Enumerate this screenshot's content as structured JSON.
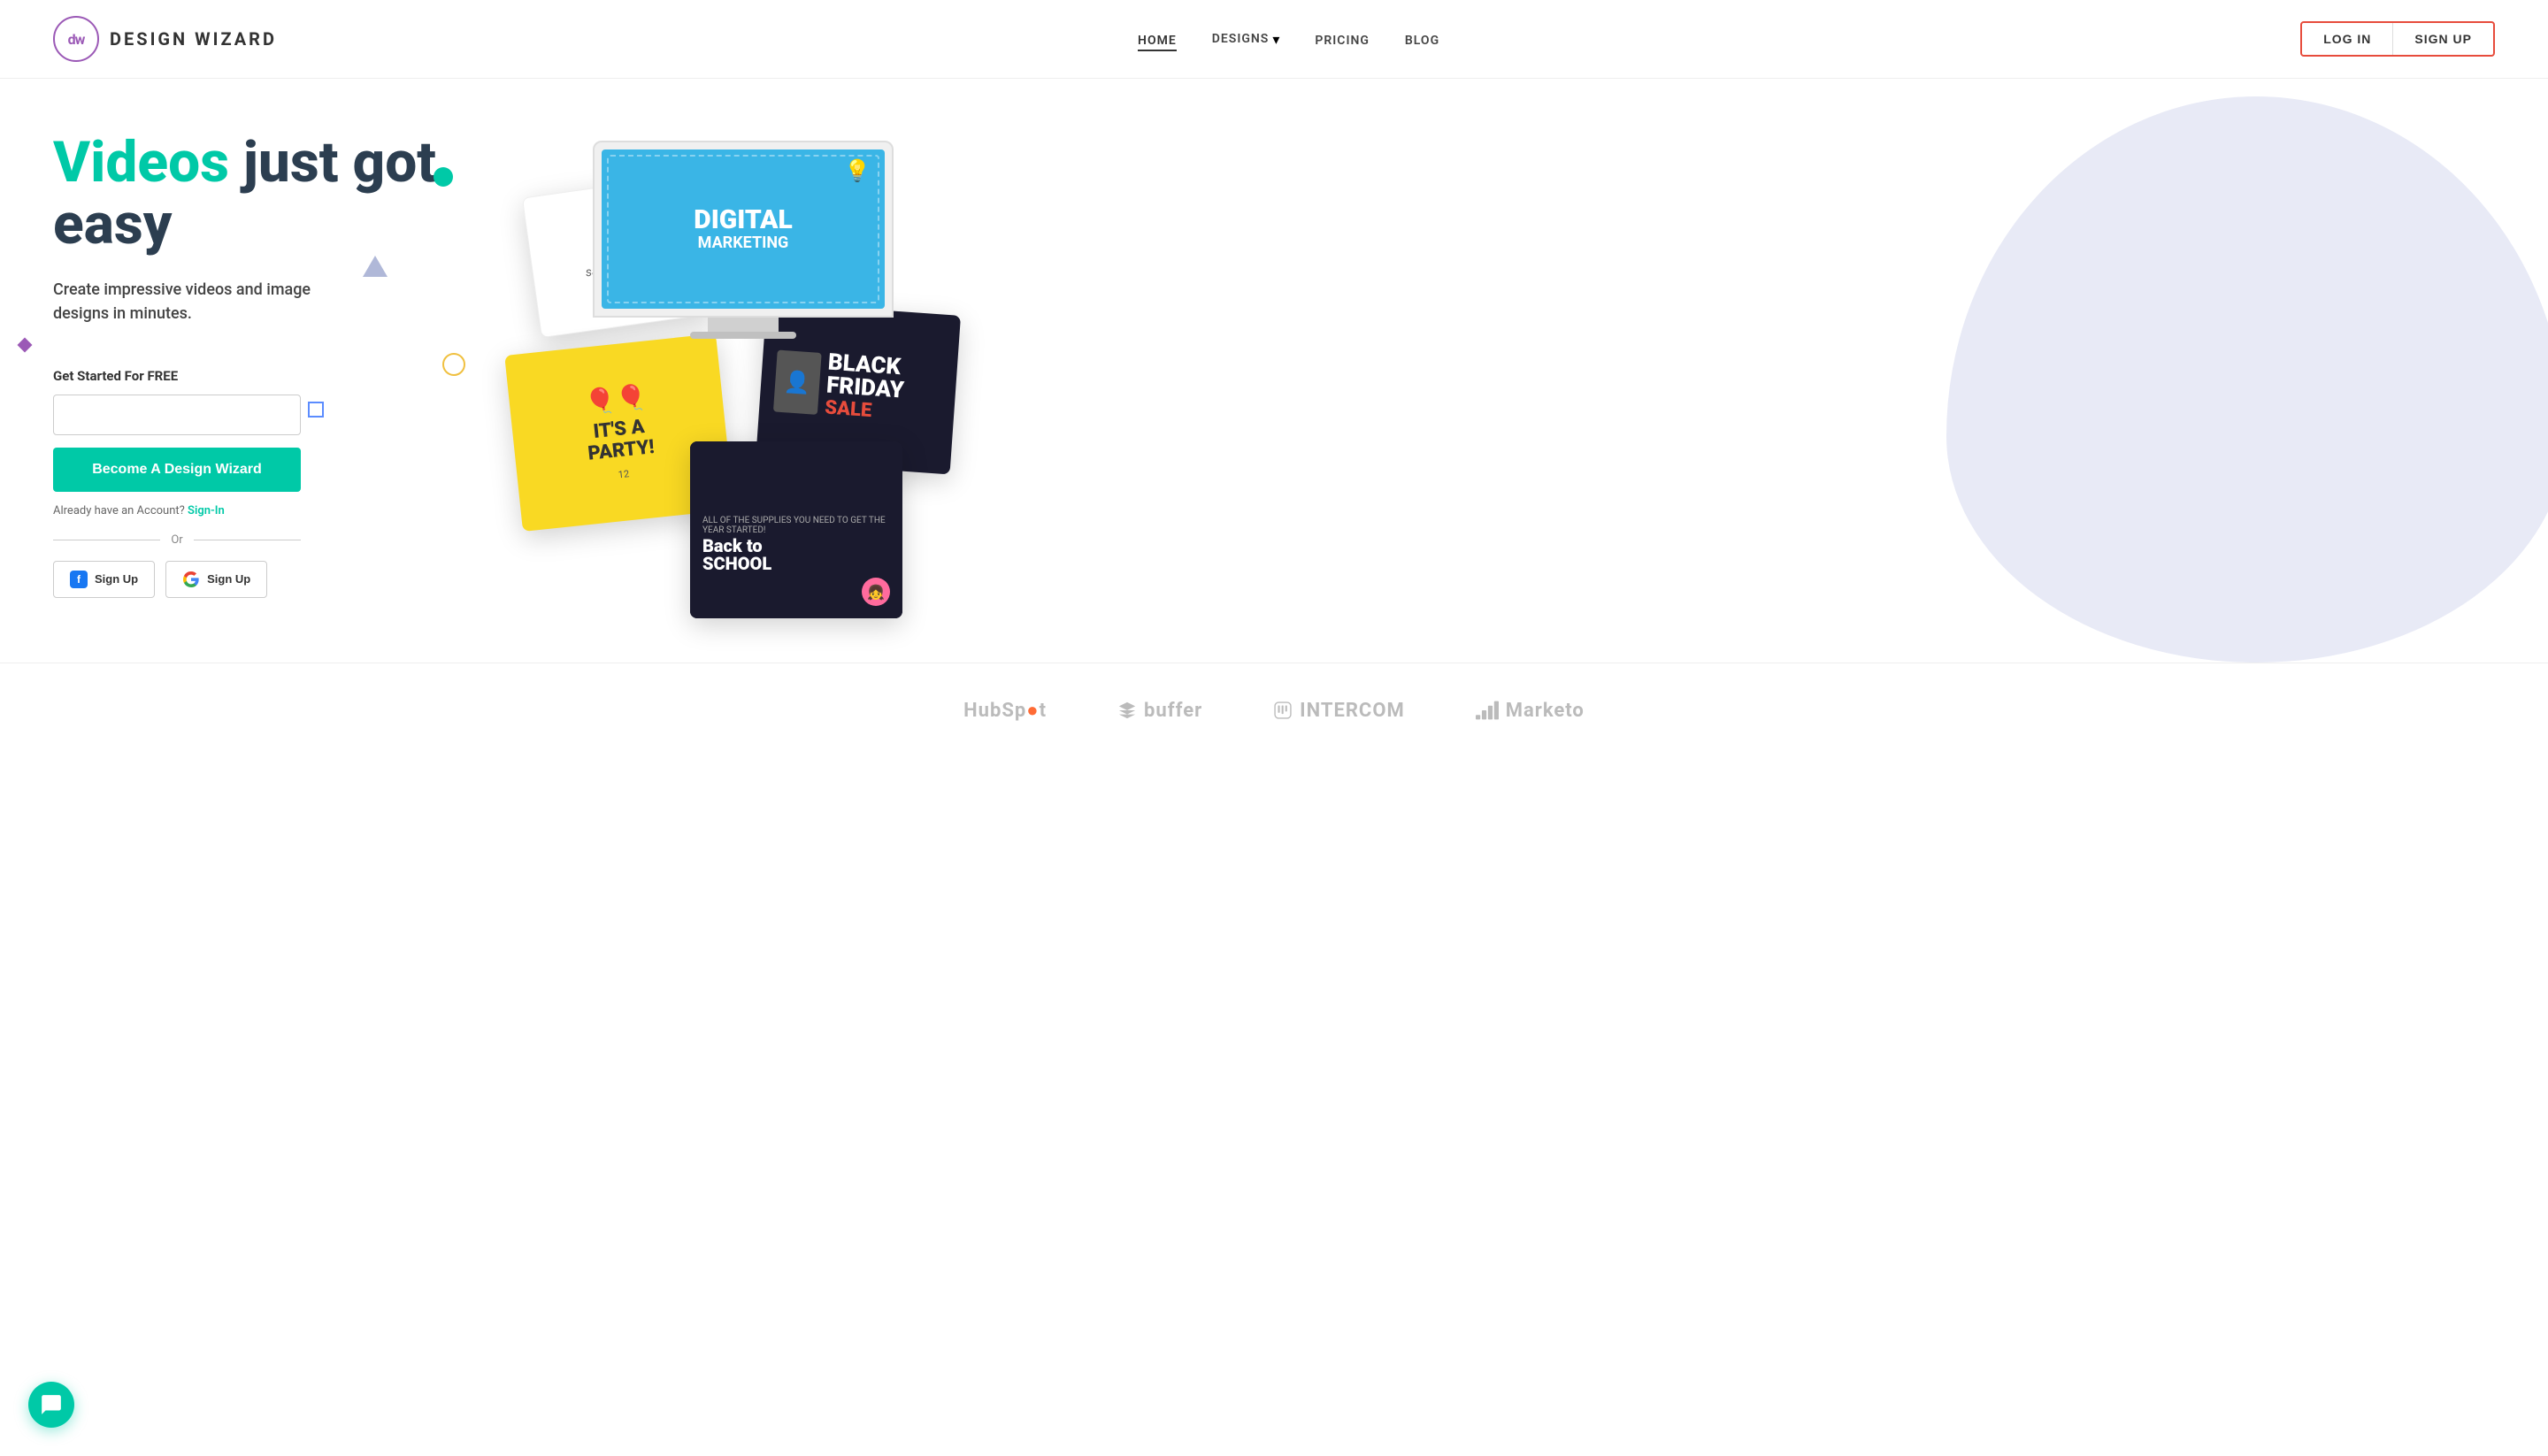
{
  "logo": {
    "initials": "dw",
    "name": "DESIGN WIZARD"
  },
  "nav": {
    "links": [
      {
        "label": "HOME",
        "active": true
      },
      {
        "label": "DESIGNS",
        "hasDropdown": true
      },
      {
        "label": "PRICING"
      },
      {
        "label": "BLOG"
      }
    ],
    "login_label": "LOG IN",
    "signup_label": "SIGN UP"
  },
  "hero": {
    "title_highlight": "Videos",
    "title_rest": " just got easy",
    "subtitle": "Create impressive videos and image\ndesigns in minutes.",
    "get_started_label": "Get Started For FREE",
    "email_placeholder": "",
    "cta_button": "Become A Design Wizard",
    "already_account_text": "Already have an Account?",
    "sign_in_label": "Sign-In",
    "or_label": "Or",
    "facebook_signup": "Sign Up",
    "google_signup": "Sign Up"
  },
  "cards": {
    "digital_marketing": "DIGITAL\nMARKETING",
    "save_date": "save the date",
    "party": "IT'S A\nPARTY!",
    "black_friday": "BLACK\nFRIDAY\nSALE",
    "back_to_school": "Back to\nSCHOOL"
  },
  "brands": [
    {
      "name": "HubSpot",
      "icon": "hubspot"
    },
    {
      "name": "buffer",
      "icon": "buffer"
    },
    {
      "name": "INTERCOM",
      "icon": "intercom"
    },
    {
      "name": "Marketo",
      "icon": "marketo"
    }
  ],
  "chat": {
    "icon": "chat-bubble-icon"
  }
}
